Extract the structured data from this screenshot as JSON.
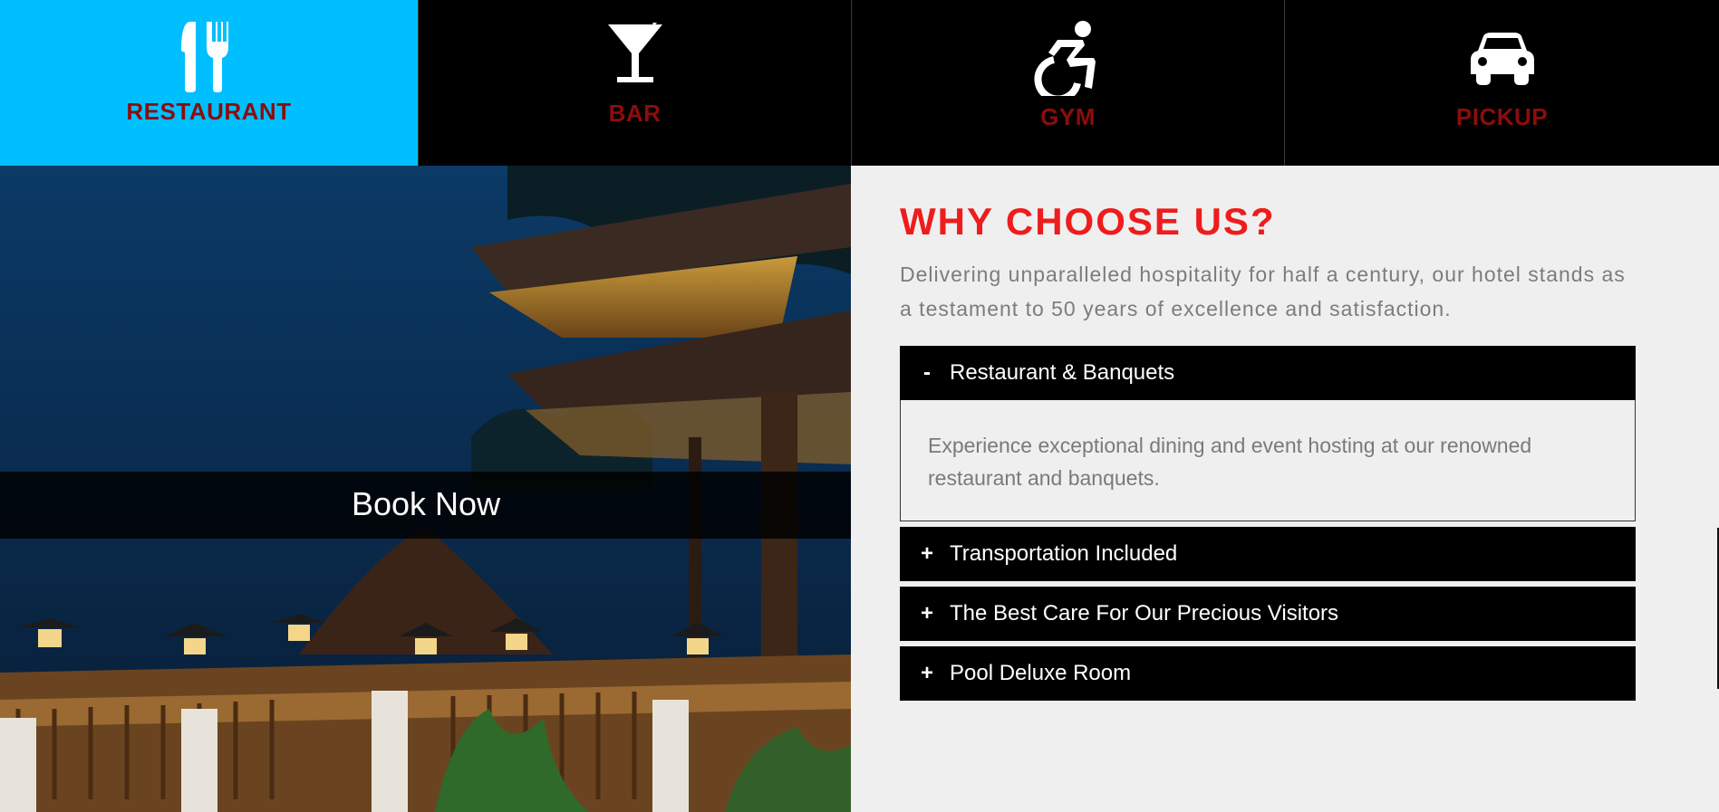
{
  "tiles": [
    {
      "label": "RESTAURANT",
      "icon": "fork-knife-icon",
      "active": true
    },
    {
      "label": "BAR",
      "icon": "cocktail-glass-icon",
      "active": false
    },
    {
      "label": "GYM",
      "icon": "wheelchair-icon",
      "active": false
    },
    {
      "label": "PICKUP",
      "icon": "car-icon",
      "active": false
    }
  ],
  "hero": {
    "image": "resort-restaurant-terrace-night-photo",
    "book_label": "Book Now"
  },
  "why": {
    "heading": "WHY CHOOSE US?",
    "intro": "Delivering unparalleled hospitality for half a century, our hotel stands as a testament to 50 years of excellence and satisfaction."
  },
  "accordion": [
    {
      "sign": "-",
      "title": "Restaurant & Banquets",
      "expanded": true,
      "body": "Experience exceptional dining and event hosting at our renowned restaurant and banquets."
    },
    {
      "sign": "+",
      "title": "Transportation Included",
      "expanded": false
    },
    {
      "sign": "+",
      "title": "The Best Care For Our Precious Visitors",
      "expanded": false
    },
    {
      "sign": "+",
      "title": "Pool Deluxe Room",
      "expanded": false
    }
  ],
  "colors": {
    "active_tile": "#00bfff",
    "tile_label": "#8b0d0d",
    "heading": "#ee1c1c",
    "accordion_header": "#000000"
  }
}
